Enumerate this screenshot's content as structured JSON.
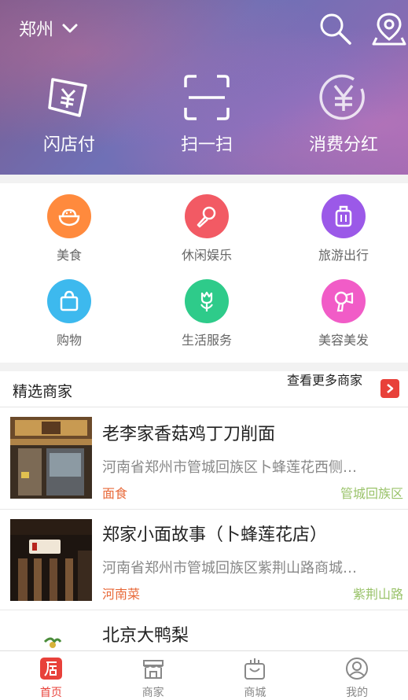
{
  "header": {
    "city": "郑州",
    "actions": [
      {
        "label": "闪店付",
        "icon": "yuan-ticket-icon"
      },
      {
        "label": "扫一扫",
        "icon": "scan-icon"
      },
      {
        "label": "消费分红",
        "icon": "yuan-coin-icon"
      }
    ]
  },
  "categories": [
    {
      "label": "美食",
      "icon": "bowl-icon",
      "color": "#ff8a3d"
    },
    {
      "label": "休闲娱乐",
      "icon": "microphone-icon",
      "color": "#f25a64"
    },
    {
      "label": "旅游出行",
      "icon": "suitcase-icon",
      "color": "#9b59e8"
    },
    {
      "label": "购物",
      "icon": "shopping-bag-icon",
      "color": "#3db9ee"
    },
    {
      "label": "生活服务",
      "icon": "tulip-icon",
      "color": "#2ecb8a"
    },
    {
      "label": "美容美发",
      "icon": "hair-dryer-icon",
      "color": "#f15cc7"
    }
  ],
  "merchants": {
    "title": "精选商家",
    "more_label": "查看更多商家",
    "items": [
      {
        "name": "老李家香菇鸡丁刀削面",
        "address": "河南省郑州市管城回族区卜蜂莲花西侧…",
        "category": "面食",
        "district": "管城回族区"
      },
      {
        "name": "郑家小面故事（卜蜂莲花店）",
        "address": "河南省郑州市管城回族区紫荆山路商城…",
        "category": "河南菜",
        "district": "紫荆山路"
      },
      {
        "name": "北京大鸭梨",
        "address": "",
        "category": "",
        "district": ""
      }
    ]
  },
  "tabbar": [
    {
      "label": "首页",
      "icon": "store-icon",
      "active": true
    },
    {
      "label": "商家",
      "icon": "shop-icon",
      "active": false
    },
    {
      "label": "商城",
      "icon": "mall-bag-icon",
      "active": false
    },
    {
      "label": "我的",
      "icon": "user-icon",
      "active": false
    }
  ],
  "colors": {
    "accent": "#e8413a",
    "category_text": "#e86a3a",
    "district_text": "#9ac36a"
  }
}
